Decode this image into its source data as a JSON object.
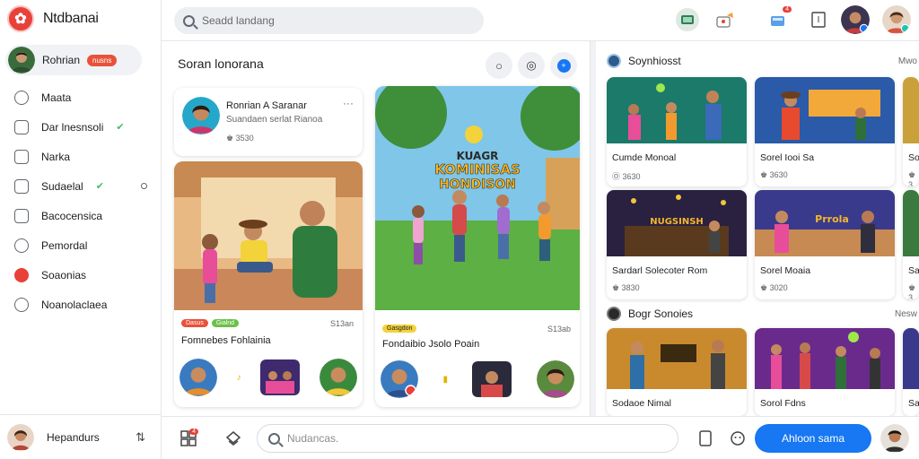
{
  "app": {
    "title": "Ntdbanai"
  },
  "sidebar": {
    "profile_name": "Rohrian",
    "profile_badge": "nusns",
    "items": [
      {
        "label": "Maata",
        "icon": "user-circle-icon"
      },
      {
        "label": "Dar lnesnsoli",
        "icon": "document-icon",
        "check": true
      },
      {
        "label": "Narka",
        "icon": "people-icon"
      },
      {
        "label": "Sudaelal",
        "icon": "settings-icon",
        "check": true
      },
      {
        "label": "Bacocensica",
        "icon": "bookmark-icon"
      },
      {
        "label": "Pemordal",
        "icon": "globe-icon"
      },
      {
        "label": "Soaonias",
        "icon": "star-icon"
      },
      {
        "label": "Noanolaclaea",
        "icon": "chat-icon"
      }
    ],
    "check_glyph": "✔",
    "bottom_name": "Hepandurs",
    "switch_glyph": "⇅"
  },
  "search": {
    "placeholder": "Seadd landang"
  },
  "topbar": {
    "badge_count": "4"
  },
  "feed": {
    "title": "Soran lonorana",
    "post_card": {
      "name": "Ronrian A Saranar",
      "subtitle": "Suandaen serlat Rianoa",
      "meta": "♚ 3530",
      "more": "···"
    },
    "cards": [
      {
        "tags": [
          "Dasus",
          "Gialnd"
        ],
        "time": "S13an",
        "title": "Fomnebes Fohlainia"
      },
      {
        "tags": [
          "Gasgdon"
        ],
        "time": "S13ab",
        "title": "Fondaibio Jsolo Poain",
        "poster_title_1": "KOMINISAS",
        "poster_title_2": "HONDISON",
        "poster_top": "KUAGR"
      }
    ]
  },
  "right": {
    "section1": {
      "title": "Soynhiosst",
      "more": "Mwo"
    },
    "section2": {
      "title": "Bogr Sonoies",
      "more": "Nesw"
    },
    "cards_row1": [
      {
        "title": "Cumde Monoal",
        "meta": "Ⓞ 3630"
      },
      {
        "title": "Sorel Iooi Sa",
        "meta": "♚ 3630"
      },
      {
        "title": "Soo",
        "meta": "♚ 3"
      }
    ],
    "cards_row2": [
      {
        "title": "Sardarl Solecoter Rom",
        "meta": "♚ 3830",
        "sign": "NUGSINSH"
      },
      {
        "title": "Sorel Moaia",
        "meta": "♚ 3020",
        "sign": "Prrola"
      },
      {
        "title": "San",
        "meta": "♚ 3"
      }
    ],
    "cards_row3": [
      {
        "title": "Sodaoe Nimal"
      },
      {
        "title": "Sorol Fdns"
      },
      {
        "title": "Sa"
      }
    ]
  },
  "bottombar": {
    "composer_placeholder": "Nudancas.",
    "action_label": "Ahloon sama",
    "badge_count": "4"
  },
  "colors": {
    "accent": "#1877f2",
    "brand": "#e8413a"
  }
}
